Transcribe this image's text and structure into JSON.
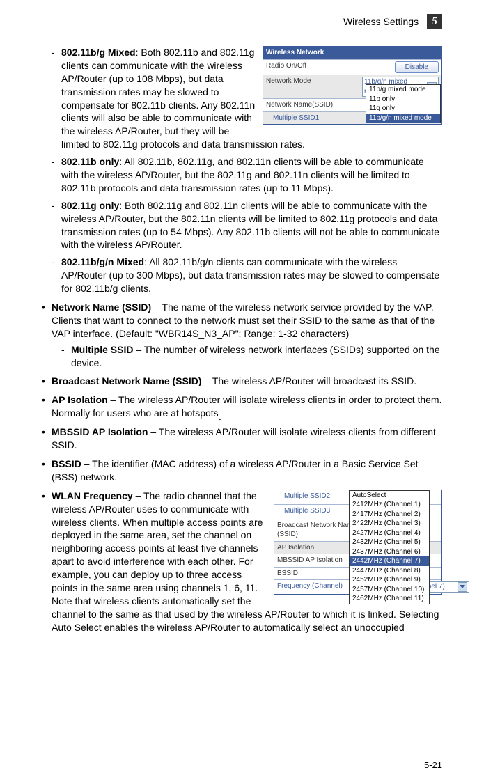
{
  "header": {
    "title": "Wireless Settings",
    "chapter": "5"
  },
  "img1": {
    "header": "Wireless Network",
    "rows": [
      {
        "label": "Radio On/Off",
        "button": "Disable"
      },
      {
        "label": "Network Mode",
        "dd": "11b/g/n mixed mode"
      },
      {
        "label": "Network Name(SSID)"
      },
      {
        "label": "Multiple SSID1",
        "indent": true
      }
    ],
    "dd_options": [
      "11b/g mixed mode",
      "11b only",
      "11g only",
      "11b/g/n mixed mode"
    ],
    "dd_selected": "11b/g/n mixed mode"
  },
  "modes": {
    "bgmixed": {
      "title": "802.11b/g Mixed",
      "text": ": Both 802.11b and 802.11g clients can communicate with the wireless AP/Router (up to 108 Mbps), but data transmission rates may be slowed to compensate for 802.11b clients. Any 802.11n clients will also be able to communicate with the wireless AP/Router, but they will be limited to 802.11g protocols and data transmission rates."
    },
    "bonly": {
      "title": "802.11b only",
      "text": ": All 802.11b, 802.11g, and 802.11n clients will be able to communicate with the wireless AP/Router, but the 802.11g and 802.11n clients will be limited to 802.11b protocols and data transmission rates (up to 11 Mbps)."
    },
    "gonly": {
      "title": "802.11g only",
      "text": ": Both 802.11g and 802.11n clients will be able to communicate with the wireless AP/Router, but the 802.11n clients will be limited to 802.11g protocols and data transmission rates (up to 54 Mbps). Any 802.11b clients will not be able to communicate with the wireless AP/Router."
    },
    "bgnmixed": {
      "title": "802.11b/g/n Mixed",
      "text": ": All 802.11b/g/n clients can communicate with the wireless AP/Router (up to 300 Mbps), but data transmission rates may be slowed to compensate for 802.11b/g clients."
    }
  },
  "items": {
    "ssid": {
      "title": "Network Name (SSID)",
      "text": " – The name of the wireless network service provided by the VAP. Clients that want to connect to the network must set their SSID to the same as that of the VAP interface. (Default: \"WBR14S_N3_AP\"; Range: 1-32 characters)"
    },
    "multssid": {
      "title": "Multiple SSID",
      "text": " – The number of wireless network interfaces (SSIDs) supported on the device."
    },
    "broadcast": {
      "title": "Broadcast Network Name (SSID)",
      "text": " – The wireless AP/Router will broadcast its SSID."
    },
    "apiso": {
      "title": "AP Isolation",
      "text": " – The wireless AP/Router will isolate wireless clients in order to protect them. Normally for users who are at hotspots"
    },
    "mbssid": {
      "title": "MBSSID AP Isolation",
      "text": " – The wireless AP/Router will isolate wireless clients from different SSID."
    },
    "bssid": {
      "title": "BSSID",
      "text": " – The identifier (MAC address) of a wireless AP/Router in a Basic Service Set (BSS) network."
    },
    "freq": {
      "title": "WLAN Frequency",
      "text": " – The radio channel that the wireless AP/Router uses to communicate with wireless clients. When multiple access points are deployed in the same area, set the channel on neighboring access points at least five channels apart to avoid interference with each other. For example, you can deploy up to three access points in the same area using channels 1, 6, 11. Note that wireless clients automatically set the channel to the same as that used by the wireless AP/Router to which it is linked. Selecting Auto Select enables the wireless AP/Router to automatically select an unoccupied"
    }
  },
  "img2": {
    "rows": [
      {
        "label": "Multiple SSID2",
        "blue": true
      },
      {
        "label": "Multiple SSID3",
        "blue": true
      },
      {
        "label": "Broadcast Network Name (SSID)"
      },
      {
        "label": "AP Isolation",
        "alt": true
      },
      {
        "label": "MBSSID AP Isolation"
      },
      {
        "label": "BSSID"
      },
      {
        "label": "Frequency (Channel)",
        "blue": true,
        "dd": "2442MHz (Channel 7)"
      }
    ],
    "dd_options": [
      "AutoSelect",
      "2412MHz (Channel 1)",
      "2417MHz (Channel 2)",
      "2422MHz (Channel 3)",
      "2427MHz (Channel 4)",
      "2432MHz (Channel 5)",
      "2437MHz (Channel 6)",
      "2442MHz (Channel 7)",
      "2447MHz (Channel 8)",
      "2452MHz (Channel 9)",
      "2457MHz (Channel 10)",
      "2462MHz (Channel 11)"
    ],
    "dd_selected": "2442MHz (Channel 7)"
  },
  "pagenum": "5-21"
}
